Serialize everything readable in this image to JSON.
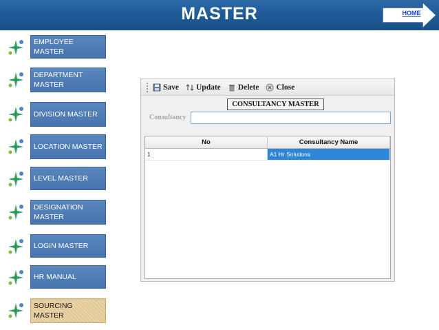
{
  "header": {
    "title": "MASTER",
    "home_label": "HOME",
    "colors": {
      "bar": "#1f5a96",
      "home_link": "#1a3fd0"
    }
  },
  "menu": [
    {
      "label": "EMPLOYEE MASTER",
      "active": false
    },
    {
      "label": "DEPARTMENT MASTER",
      "active": false
    },
    {
      "label": "DIVISION MASTER",
      "active": false
    },
    {
      "label": "LOCATION MASTER",
      "active": false
    },
    {
      "label": "LEVEL MASTER",
      "active": false
    },
    {
      "label": "DESIGNATION MASTER",
      "active": false
    },
    {
      "label": "LOGIN MASTER",
      "active": false
    },
    {
      "label": "HR MANUAL",
      "active": false
    },
    {
      "label": "SOURCING MASTER",
      "active": true
    }
  ],
  "menu_icon": "sparkle-cross-icon",
  "form": {
    "toolbar": {
      "save_label": "Save",
      "update_label": "Update",
      "delete_label": "Delete",
      "close_label": "Close"
    },
    "title": "CONSULTANCY MASTER",
    "consultancy_label": "Consultancy",
    "consultancy_value": "",
    "grid": {
      "columns": [
        "No",
        "Consultancy Name"
      ],
      "rows": [
        {
          "no": "1",
          "name": "A1 Hr Solutions"
        }
      ]
    },
    "colors": {
      "selection": "#2f86d6",
      "input_border": "#7ba7d6"
    }
  }
}
